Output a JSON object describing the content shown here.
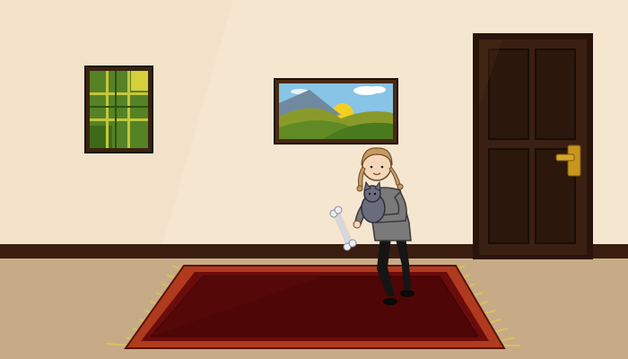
{
  "scene": {
    "name": "living-room",
    "colors": {
      "wall": "#f5e6d0",
      "wall_shadow": "#e9d4b8",
      "baseboard": "#3a1d10",
      "floor": "#c6ab86",
      "door": "#3a2012",
      "door_panel": "#2c170c",
      "door_handle": "#c8961e",
      "frame": "#4a2a14",
      "rug_fringe": "#d8c060",
      "rug_border": "#b03a1e",
      "rug_inner": "#6a0c0c",
      "rug_center": "#4e0606"
    },
    "objects": [
      {
        "id": "plaid-painting",
        "description_icon": "plaid-painting-icon"
      },
      {
        "id": "landscape-painting",
        "description_icon": "landscape-painting-icon"
      },
      {
        "id": "wooden-door",
        "description_icon": "door-icon"
      },
      {
        "id": "red-rug",
        "description_icon": "rug-icon"
      },
      {
        "id": "girl-holding-cat",
        "description_icon": "girl-icon"
      },
      {
        "id": "bone",
        "description_icon": "bone-icon"
      }
    ]
  }
}
